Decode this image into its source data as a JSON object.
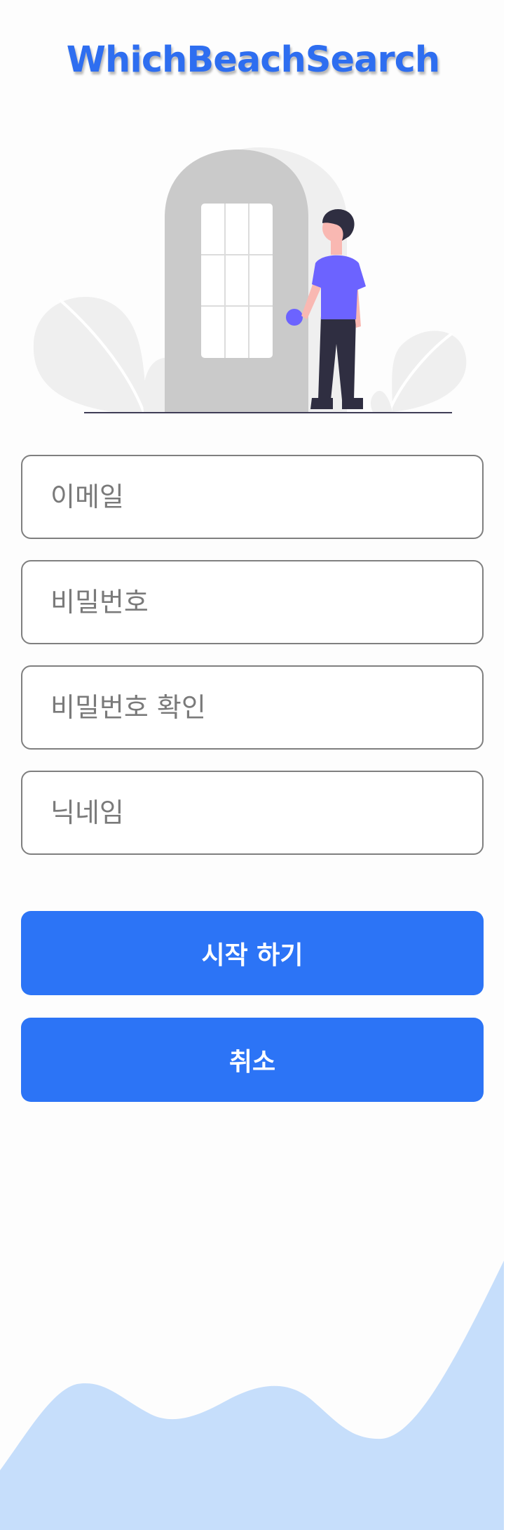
{
  "app": {
    "title": "WhichBeachSearch"
  },
  "form": {
    "email_placeholder": "이메일",
    "password_placeholder": "비밀번호",
    "password_confirm_placeholder": "비밀번호 확인",
    "nickname_placeholder": "닉네임"
  },
  "actions": {
    "start_label": "시작 하기",
    "cancel_label": "취소"
  },
  "colors": {
    "accent": "#2c74f6",
    "title": "#2e6ef0",
    "wave": "#c6defb",
    "figure_shirt": "#6c63ff"
  },
  "icons": {
    "hero": "person-at-door-illustration"
  }
}
